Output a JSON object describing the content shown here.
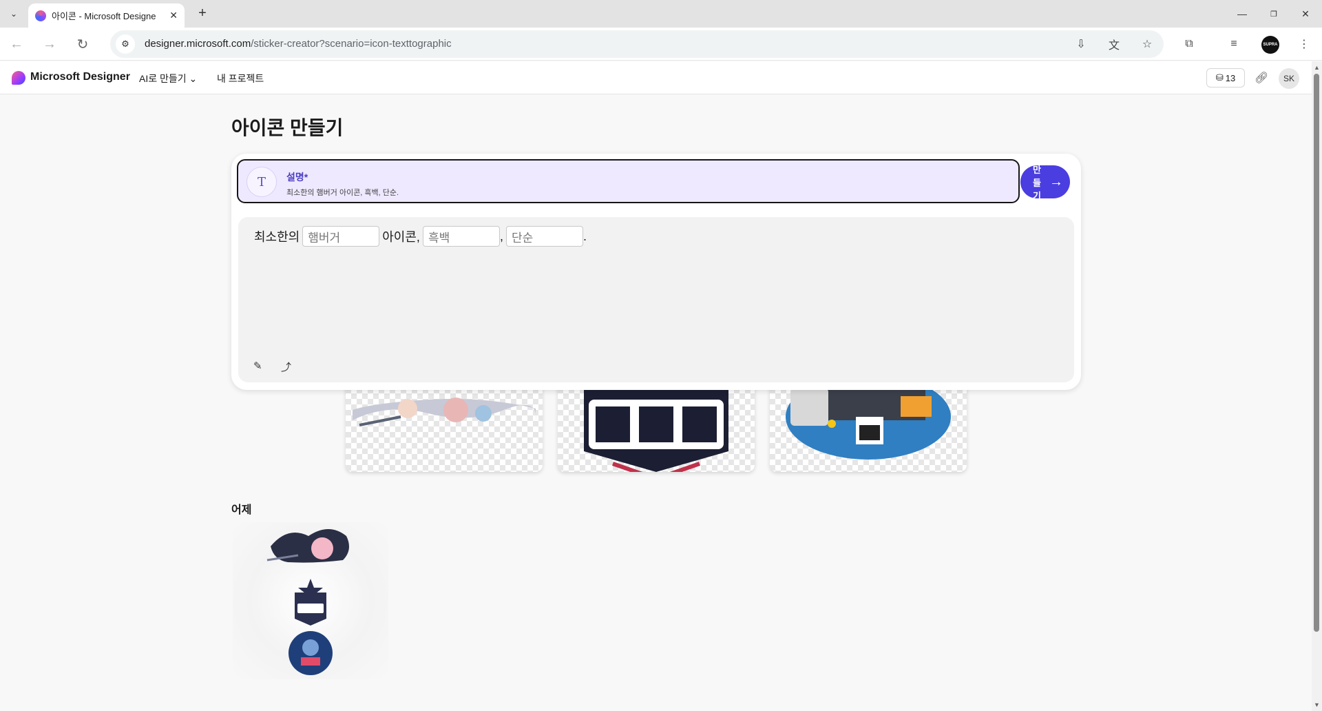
{
  "browser": {
    "tab_title": "아이콘 - Microsoft Designe",
    "url_host": "designer.microsoft.com",
    "url_path": "/sticker-creator?scenario=icon-texttographic",
    "profile_label": "SUPRA"
  },
  "app": {
    "brand": "Microsoft Designer",
    "nav_create": "AI로 만들기",
    "nav_projects": "내 프로젝트",
    "credits": "13",
    "user_initials": "SK"
  },
  "page": {
    "title": "아이콘 만들기",
    "description_label": "설명*",
    "description_text": "최소한의 햄버거 아이콘, 흑백, 단순.",
    "make_button_label": "만들기",
    "sentence": {
      "prefix": "최소한의",
      "field1_placeholder": "햄버거",
      "mid": "아이콘,",
      "field2_placeholder": "흑백",
      "sep": ",",
      "field3_placeholder": "단순",
      "suffix": "."
    },
    "yesterday_label": "어제"
  },
  "colors": {
    "accent": "#4a3ee0",
    "description_bg": "#efe9ff",
    "description_label": "#4b3fc2"
  },
  "icons": {
    "new_tab": "plus-icon",
    "back": "arrow-left-icon",
    "forward": "arrow-right-icon",
    "reload": "reload-icon",
    "site_info": "tune-icon",
    "install": "install-icon",
    "translate": "translate-icon",
    "bookmark": "star-icon",
    "extensions": "puzzle-icon",
    "media": "playlist-icon",
    "menu": "kebab-icon",
    "credits": "coin-stack-icon",
    "share": "link-icon",
    "text_input": "text-plus-icon",
    "make_arrow": "arrow-right-icon",
    "rewrite": "pen-sparkle-icon",
    "share_prompt": "share-icon"
  }
}
